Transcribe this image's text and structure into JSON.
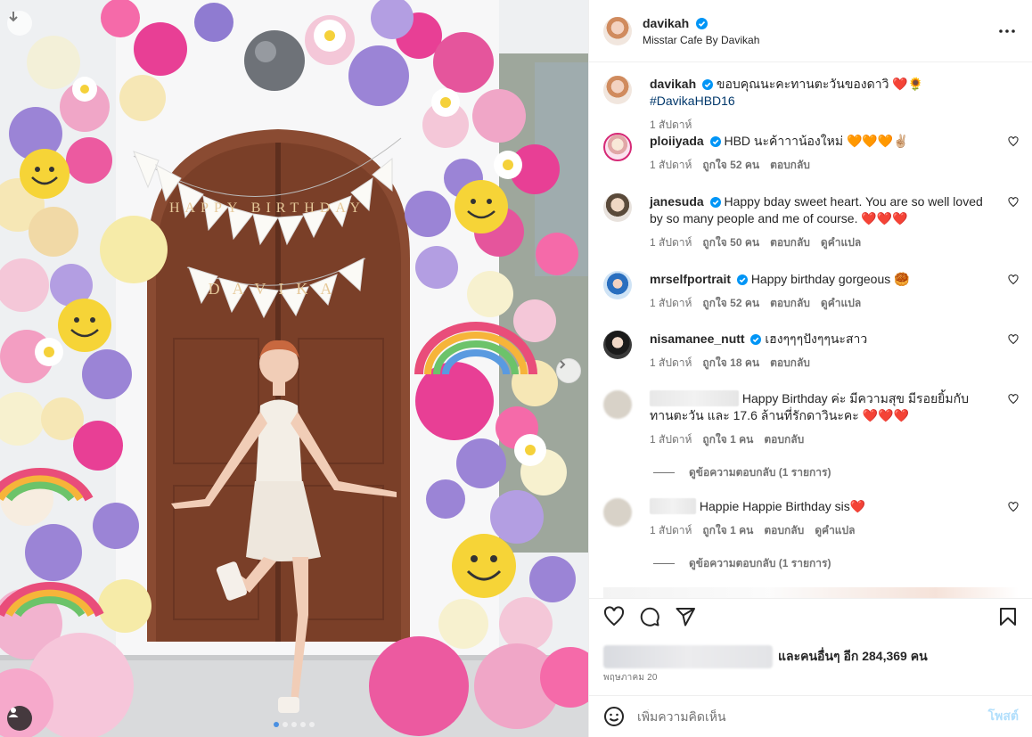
{
  "post": {
    "username": "davikah",
    "location": "Misstar Cafe By Davikah",
    "caption_user": "davikah",
    "caption_text": "ขอบคุณนะคะทานตะวันของดาวิ ❤️🌻",
    "caption_hashtag": "#DavikaHBD16",
    "caption_time": "1 สัปดาห์",
    "likes_suffix": "และคนอื่นๆ อีก 284,369 คน",
    "date": "พฤษภาคม 20",
    "add_comment_placeholder": "เพิ่มความคิดเห็น",
    "post_button": "โพสต์"
  },
  "photo": {
    "banner_top": "HAPPY BIRTHDAY",
    "banner_bottom": "DAVIKA"
  },
  "comments": [
    {
      "user": "ploiiyada",
      "text": "HBD นะค้าาาน้องใหม่ 🧡🧡🧡✌🏼",
      "time": "1 สัปดาห์",
      "likes": "ถูกใจ 52 คน",
      "reply": "ตอบกลับ",
      "translate": ""
    },
    {
      "user": "janesuda",
      "text": "Happy bday sweet heart. You are so well loved by so many people and me of course. ❤️❤️❤️",
      "time": "1 สัปดาห์",
      "likes": "ถูกใจ 50 คน",
      "reply": "ตอบกลับ",
      "translate": "ดูคำแปล"
    },
    {
      "user": "mrselfportrait",
      "text": "Happy birthday gorgeous 🥮",
      "time": "1 สัปดาห์",
      "likes": "ถูกใจ 52 คน",
      "reply": "ตอบกลับ",
      "translate": "ดูคำแปล"
    },
    {
      "user": "nisamanee_nutt",
      "text": "เฮงๆๆๆปังๆๆนะสาว",
      "time": "1 สัปดาห์",
      "likes": "ถูกใจ 18 คน",
      "reply": "ตอบกลับ",
      "translate": ""
    },
    {
      "user": "",
      "text": "Happy Birthday ค่ะ มีความสุข มีรอยยิ้มกับทานตะวัน และ 17.6 ล้านที่รักดาวินะคะ ❤️❤️❤️",
      "time": "1 สัปดาห์",
      "likes": "ถูกใจ 1 คน",
      "reply": "ตอบกลับ",
      "translate": "",
      "view_replies": "ดูข้อความตอบกลับ (1 รายการ)"
    },
    {
      "user": "",
      "text": "Happie Happie Birthday sis❤️",
      "time": "1 สัปดาห์",
      "likes": "ถูกใจ 1 คน",
      "reply": "ตอบกลับ",
      "translate": "ดูคำแปล",
      "view_replies": "ดูข้อความตอบกลับ (1 รายการ)"
    }
  ],
  "colors": {
    "verified": "#0095f6",
    "link": "#00376b",
    "muted": "#737373",
    "post_disabled": "#b2dffc"
  },
  "icons": [
    "download-icon",
    "chevron-right-icon",
    "user-tag-icon",
    "more-icon",
    "verified-icon",
    "heart-icon",
    "comment-icon",
    "share-icon",
    "bookmark-icon",
    "emoji-icon"
  ]
}
